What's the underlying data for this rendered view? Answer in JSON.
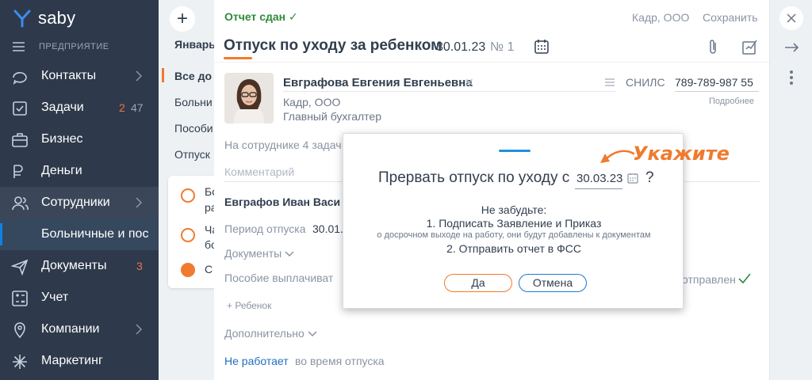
{
  "sidebar": {
    "logo_text": "saby",
    "org_label": "ПРЕДПРИЯТИЕ",
    "items": [
      {
        "label": "Контакты"
      },
      {
        "label": "Задачи",
        "badge_new": "2",
        "badge_total": "47"
      },
      {
        "label": "Бизнес"
      },
      {
        "label": "Деньги"
      },
      {
        "label": "Сотрудники"
      },
      {
        "label": "Больничные и пос"
      },
      {
        "label": "Документы",
        "badge_new": "3"
      },
      {
        "label": "Учет"
      },
      {
        "label": "Компании"
      },
      {
        "label": "Маркетинг"
      }
    ]
  },
  "col2": {
    "add": "+",
    "month": "Январь",
    "items": [
      "Все до",
      "Больни",
      "Пособи",
      "Отпуск"
    ],
    "card_items": [
      "Бо",
      "ра",
      "Ча",
      "бо",
      "С"
    ]
  },
  "doc": {
    "status": "Отчет сдан",
    "org": "Кадр, ООО",
    "save": "Сохранить",
    "title": "Отпуск по уходу за ребенком",
    "date": "30.01.23",
    "number": "№ 1",
    "employee": {
      "name": "Евграфова Евгения Евгеньевна",
      "org": "Кадр, ООО",
      "position": "Главный бухгалтер",
      "snils_label": "СНИЛС",
      "snils": "789-789-987 55",
      "more": "Подробнее"
    },
    "tasks": "На сотруднике 4 задач",
    "comment_placeholder": "Комментарий",
    "child_parent": "Евграфов Иван Васи",
    "period_label": "Период отпуска",
    "period_value": "30.01.",
    "documents": "Документы",
    "benefit": "Пособие выплачиват",
    "sent": "отправлен",
    "add_child": "+ Ребенок",
    "additional": "Дополнительно",
    "not_working": "Не работает",
    "during": "во время отпуска"
  },
  "dialog": {
    "question": "Прервать отпуск по уходу с",
    "date": "30.03.23",
    "qmark": "?",
    "reminder": "Не забудьте:",
    "step1": "1. Подписать Заявление и Приказ",
    "step1_note": "о досрочном выходе на работу, они будут добавлены к документам",
    "step2": "2. Отправить отчет в ФСС",
    "yes": "Да",
    "no": "Отмена"
  },
  "hint": "Укажите",
  "colors": {
    "sidebar_bg": "#2E3A4B",
    "accent_orange": "#F07A2E",
    "accent_blue": "#1E90E0",
    "status_green": "#2E8B3B"
  }
}
